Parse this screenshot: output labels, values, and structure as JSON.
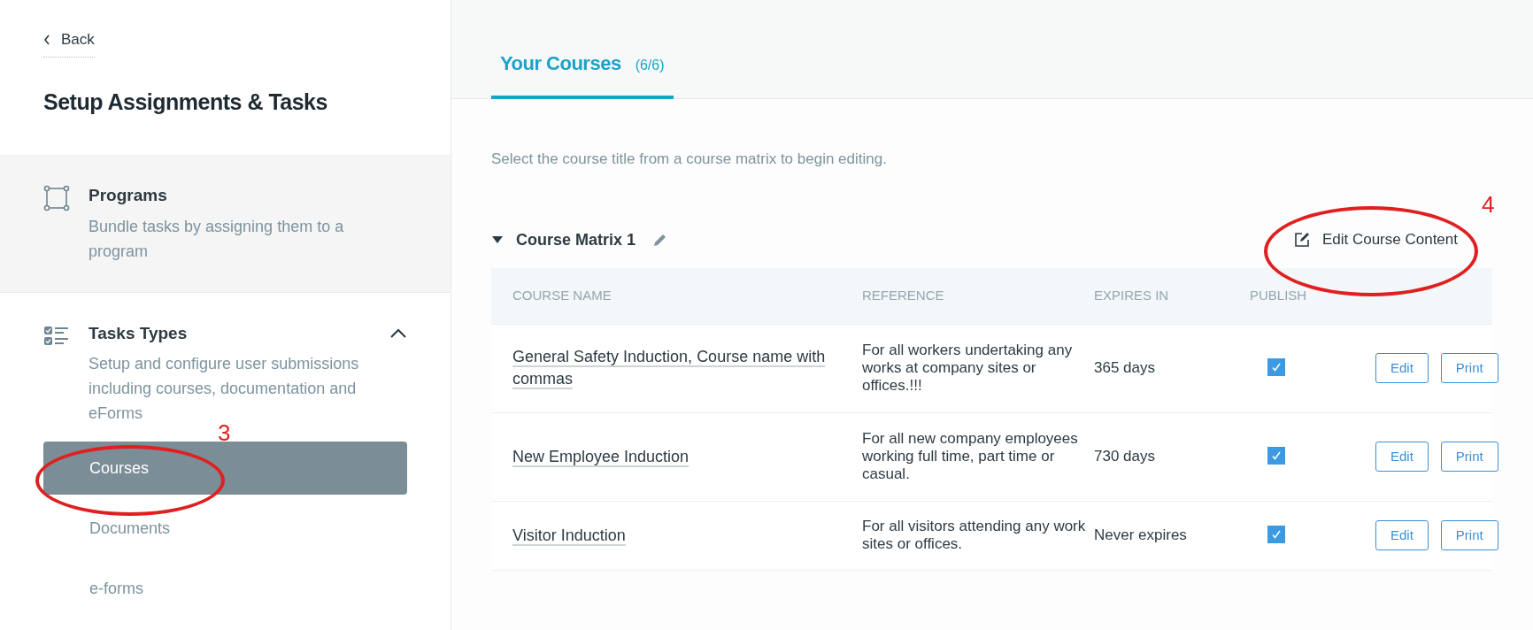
{
  "sidebar": {
    "back": "Back",
    "title": "Setup Assignments & Tasks",
    "sections": [
      {
        "kind": "programs",
        "title": "Programs",
        "description": "Bundle tasks by assigning them to a program"
      },
      {
        "kind": "tasks",
        "title": "Tasks Types",
        "description": "Setup and configure user submissions including courses, documentation and eForms",
        "expanded": true,
        "items": [
          {
            "label": "Courses",
            "selected": true
          },
          {
            "label": "Documents",
            "selected": false
          },
          {
            "label": "e-forms",
            "selected": false
          }
        ]
      }
    ]
  },
  "tabs": [
    {
      "label": "Your Courses",
      "count": "(6/6)",
      "selected": true
    }
  ],
  "instruction": "Select the course title from a course matrix to begin editing.",
  "matrix": {
    "title": "Course Matrix 1",
    "expanded": true,
    "action": "Edit Course Content",
    "table": {
      "columns": [
        "COURSE NAME",
        "REFERENCE",
        "EXPIRES IN",
        "PUBLISH"
      ],
      "rows": [
        {
          "name": "General Safety Induction, Course name with commas",
          "reference": "For all workers undertaking any works at company sites or offices.!!!",
          "expires": "365 days",
          "publish": true,
          "buttons": [
            "Edit",
            "Print"
          ]
        },
        {
          "name": "New Employee Induction",
          "reference": "For all new company employees working full time, part time or casual.",
          "expires": "730 days",
          "publish": true,
          "buttons": [
            "Edit",
            "Print"
          ]
        },
        {
          "name": "Visitor Induction",
          "reference": "For all visitors attending any work sites or offices.",
          "expires": "Never expires",
          "publish": true,
          "buttons": [
            "Edit",
            "Print"
          ]
        }
      ]
    }
  },
  "annotations": [
    {
      "label": "3"
    },
    {
      "label": "4"
    }
  ]
}
